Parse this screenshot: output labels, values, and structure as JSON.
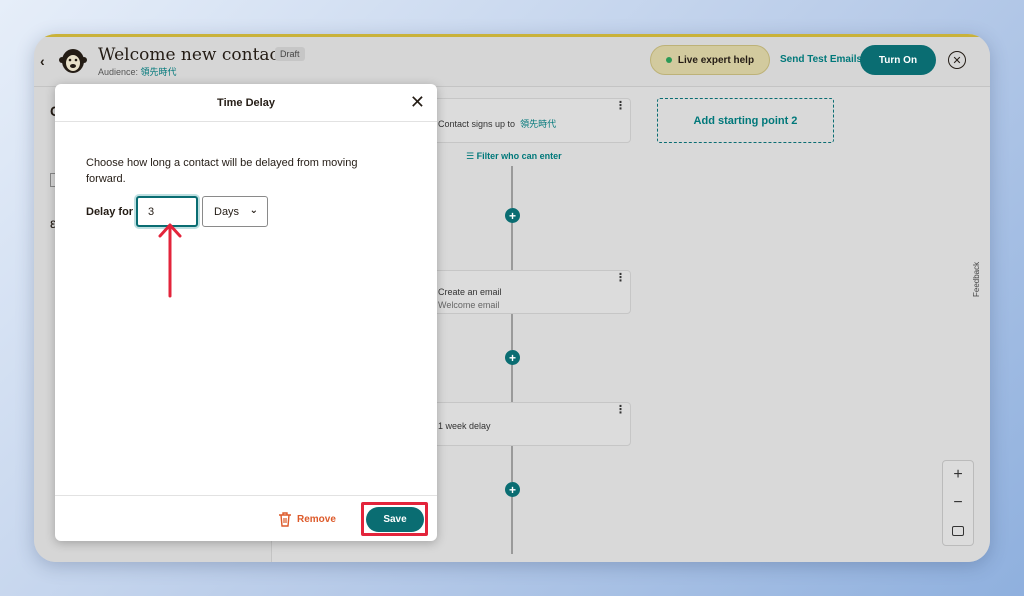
{
  "header": {
    "title": "Welcome new contacts",
    "badge": "Draft",
    "audience_label": "Audience:",
    "audience_name": "領先時代",
    "expert_help": "Live expert help",
    "send_test": "Send Test Emails",
    "turn_on": "Turn On"
  },
  "left_panel": {
    "heading_initial": "C",
    "section_initial": "ε"
  },
  "canvas": {
    "trigger_text": "Contact signs up to",
    "trigger_audience": "領先時代",
    "filter_label": "Filter who can enter",
    "add_starting_point": "Add starting point 2",
    "steps": [
      {
        "title": "Create an email",
        "subtitle": "Welcome email"
      },
      {
        "title": "1 week delay",
        "subtitle": ""
      }
    ],
    "feedback_label": "Feedback"
  },
  "modal": {
    "title": "Time Delay",
    "description": "Choose how long a contact will be delayed from moving forward.",
    "delay_label": "Delay for",
    "delay_value": "3",
    "unit_selected": "Days",
    "remove_label": "Remove",
    "save_label": "Save"
  },
  "colors": {
    "primary": "#0a6d72",
    "highlight": "#e3243b",
    "remove": "#dd5a2a"
  }
}
